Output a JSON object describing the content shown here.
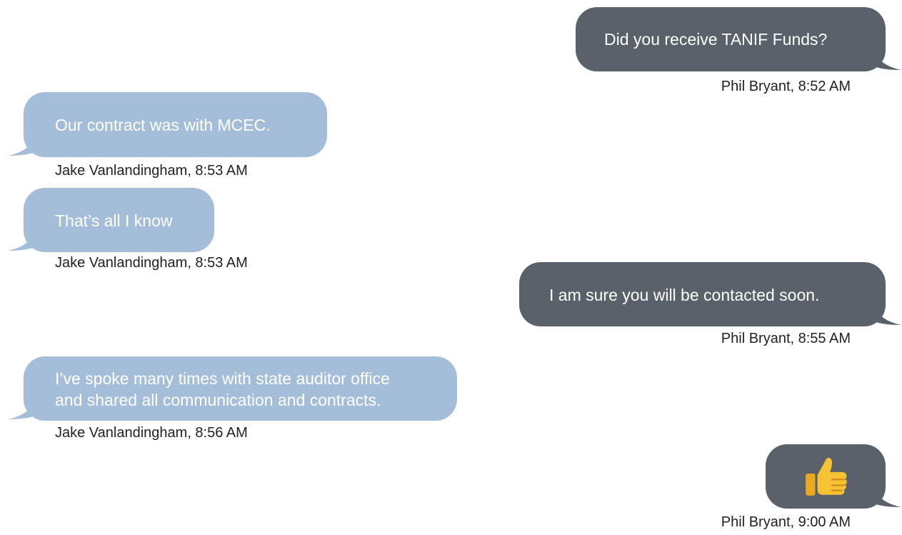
{
  "colors": {
    "incoming_bubble": "#a4bed9",
    "outgoing_bubble": "#5b616a",
    "bubble_text": "#ffffff",
    "meta_text": "#222222"
  },
  "messages": [
    {
      "direction": "outgoing",
      "text": "Did you receive TANIF Funds?",
      "meta": "Phil Bryant, 8:52 AM"
    },
    {
      "direction": "incoming",
      "text": "Our contract was with MCEC.",
      "meta": "Jake Vanlandingham, 8:53 AM"
    },
    {
      "direction": "incoming",
      "text": "That’s all I know",
      "meta": "Jake Vanlandingham, 8:53 AM"
    },
    {
      "direction": "outgoing",
      "text": "I am sure you will be contacted soon.",
      "meta": "Phil Bryant, 8:55 AM"
    },
    {
      "direction": "incoming",
      "lines": [
        "I’ve spoke many times with state auditor office",
        "and shared all communication and contracts."
      ],
      "meta": "Jake Vanlandingham, 8:56 AM"
    },
    {
      "direction": "outgoing",
      "icon": "thumbs-up-icon",
      "meta": "Phil Bryant, 9:00 AM"
    }
  ]
}
